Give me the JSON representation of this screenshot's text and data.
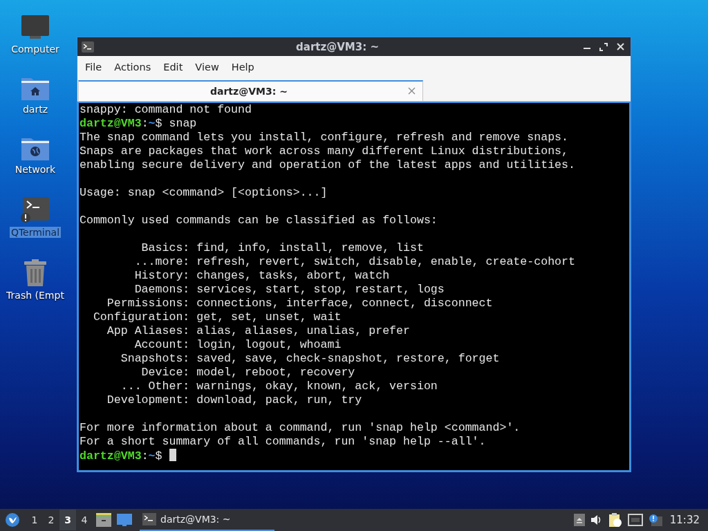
{
  "desktop_icons": [
    {
      "kind": "computer",
      "label": "Computer",
      "selected": false
    },
    {
      "kind": "home-folder",
      "label": "dartz",
      "selected": false
    },
    {
      "kind": "network-folder",
      "label": "Network",
      "selected": false
    },
    {
      "kind": "terminal",
      "label": "QTerminal",
      "selected": true
    },
    {
      "kind": "trash",
      "label": "Trash (Empt",
      "selected": false
    }
  ],
  "window": {
    "title": "dartz@VM3: ~",
    "menu": [
      "File",
      "Actions",
      "Edit",
      "View",
      "Help"
    ],
    "tabs": [
      {
        "label": "dartz@VM3: ~",
        "selected": true
      }
    ],
    "terminal_lines": [
      {
        "kind": "text",
        "text": "snappy: command not found"
      },
      {
        "kind": "prompt",
        "user": "dartz@VM3",
        "sep": ":",
        "path": "~",
        "command": "$ snap"
      },
      {
        "kind": "text",
        "text": "The snap command lets you install, configure, refresh and remove snaps."
      },
      {
        "kind": "text",
        "text": "Snaps are packages that work across many different Linux distributions,"
      },
      {
        "kind": "text",
        "text": "enabling secure delivery and operation of the latest apps and utilities."
      },
      {
        "kind": "blank"
      },
      {
        "kind": "text",
        "text": "Usage: snap <command> [<options>...]"
      },
      {
        "kind": "blank"
      },
      {
        "kind": "text",
        "text": "Commonly used commands can be classified as follows:"
      },
      {
        "kind": "blank"
      },
      {
        "kind": "text",
        "text": "         Basics: find, info, install, remove, list"
      },
      {
        "kind": "text",
        "text": "        ...more: refresh, revert, switch, disable, enable, create-cohort"
      },
      {
        "kind": "text",
        "text": "        History: changes, tasks, abort, watch"
      },
      {
        "kind": "text",
        "text": "        Daemons: services, start, stop, restart, logs"
      },
      {
        "kind": "text",
        "text": "    Permissions: connections, interface, connect, disconnect"
      },
      {
        "kind": "text",
        "text": "  Configuration: get, set, unset, wait"
      },
      {
        "kind": "text",
        "text": "    App Aliases: alias, aliases, unalias, prefer"
      },
      {
        "kind": "text",
        "text": "        Account: login, logout, whoami"
      },
      {
        "kind": "text",
        "text": "      Snapshots: saved, save, check-snapshot, restore, forget"
      },
      {
        "kind": "text",
        "text": "         Device: model, reboot, recovery"
      },
      {
        "kind": "text",
        "text": "      ... Other: warnings, okay, known, ack, version"
      },
      {
        "kind": "text",
        "text": "    Development: download, pack, run, try"
      },
      {
        "kind": "blank"
      },
      {
        "kind": "text",
        "text": "For more information about a command, run 'snap help <command>'."
      },
      {
        "kind": "text",
        "text": "For a short summary of all commands, run 'snap help --all'."
      },
      {
        "kind": "prompt",
        "user": "dartz@VM3",
        "sep": ":",
        "path": "~",
        "command": "$",
        "cursor": true
      }
    ]
  },
  "taskbar": {
    "workspaces": [
      {
        "label": "1",
        "selected": false
      },
      {
        "label": "2",
        "selected": false
      },
      {
        "label": "3",
        "selected": true
      },
      {
        "label": "4",
        "selected": false
      }
    ],
    "tasks": [
      {
        "label": "dartz@VM3: ~",
        "selected": true
      }
    ],
    "clock": "11:32"
  }
}
